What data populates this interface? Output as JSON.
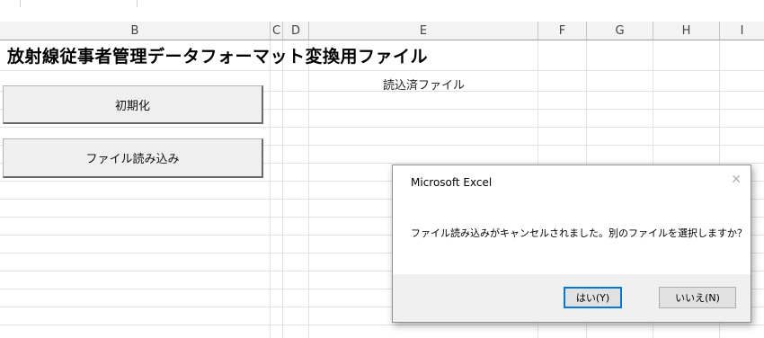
{
  "columns": [
    "B",
    "C",
    "D",
    "E",
    "F",
    "G",
    "H",
    "I"
  ],
  "sheet": {
    "title": "放射線従事者管理データフォーマット変換用ファイル",
    "loaded_files_label": "読込済ファイル",
    "init_button": "初期化",
    "load_button": "ファイル読み込み"
  },
  "dialog": {
    "title": "Microsoft Excel",
    "message": "ファイル読み込みがキャンセルされました。別のファイルを選択しますか？",
    "yes_button": "はい(Y)",
    "no_button": "いいえ(N)",
    "close_icon": "close-icon"
  }
}
